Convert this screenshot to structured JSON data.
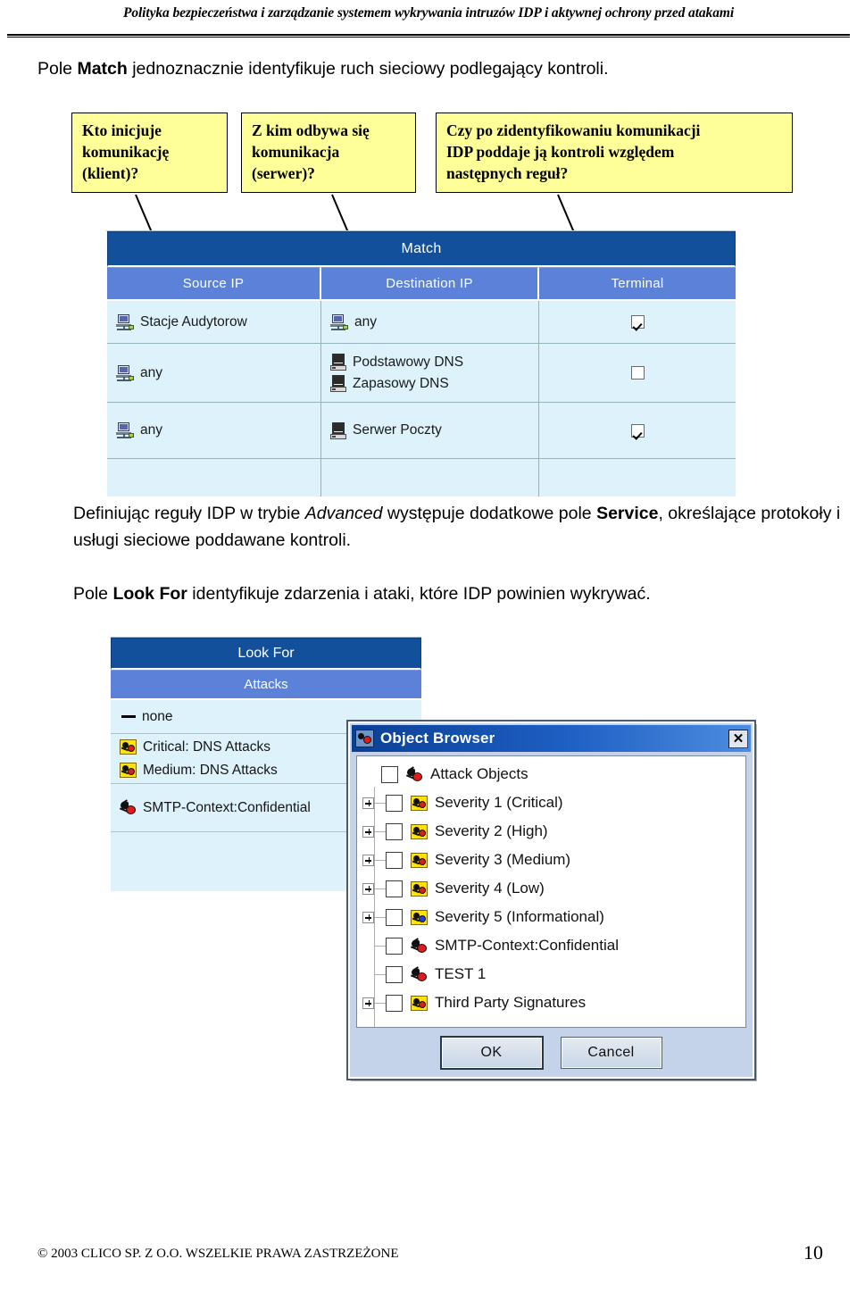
{
  "header": {
    "running_title": "Polityka bezpieczeństwa i zarządzanie systemem wykrywania intruzów IDP i aktywnej ochrony przed atakami"
  },
  "paragraphs": {
    "p1_prefix": "Pole ",
    "p1_bold": "Match",
    "p1_suffix": " jednoznacznie identyfikuje ruch sieciowy podlegający kontroli.",
    "p2_a": "Definiując reguły IDP w trybie ",
    "p2_italic": "Advanced",
    "p2_b": " występuje dodatkowe pole ",
    "p2_bold": "Service",
    "p2_c": ", określające protokoły i usługi sieciowe poddawane kontroli.",
    "p3_prefix": "Pole ",
    "p3_bold": "Look For",
    "p3_suffix": " identyfikuje zdarzenia i ataki, które IDP powinien wykrywać."
  },
  "callouts": [
    {
      "name": "callout-source",
      "lines": [
        "Kto inicjuje",
        "komunikację",
        "(klient)?"
      ]
    },
    {
      "name": "callout-destination",
      "lines": [
        "Z kim odbywa się",
        "komunikacja",
        "(serwer)?"
      ]
    },
    {
      "name": "callout-terminal",
      "lines": [
        "Czy po zidentyfikowaniu komunikacji",
        "IDP poddaje ją kontroli względem",
        "następnych reguł?"
      ]
    }
  ],
  "match_table": {
    "title": "Match",
    "columns": [
      "Source IP",
      "Destination IP",
      "Terminal"
    ],
    "rows": [
      {
        "source": [
          "Stacje Audytorow"
        ],
        "source_icon": "network-icon",
        "destination": [
          "any"
        ],
        "destination_icon": "network-icon",
        "terminal": true
      },
      {
        "source": [
          "any"
        ],
        "source_icon": "network-icon",
        "destination": [
          "Podstawowy DNS",
          "Zapasowy DNS"
        ],
        "destination_icon": "server-icon",
        "terminal": false
      },
      {
        "source": [
          "any"
        ],
        "source_icon": "network-icon",
        "destination": [
          "Serwer Poczty"
        ],
        "destination_icon": "server-icon",
        "terminal": true
      },
      {
        "source": [],
        "destination": [],
        "terminal": null
      }
    ],
    "colors": {
      "title_bg": "#13509c",
      "column_bg": "#5b82d8",
      "row_bg": "#ddf2fb"
    }
  },
  "look_for": {
    "title": "Look For",
    "subtitle": "Attacks",
    "groups": [
      {
        "items": [
          {
            "icon": "dash-icon",
            "label": "none"
          }
        ]
      },
      {
        "items": [
          {
            "icon": "severity-icon",
            "label": "Critical: DNS Attacks"
          },
          {
            "icon": "severity-icon",
            "label": "Medium: DNS Attacks"
          }
        ]
      },
      {
        "items": [
          {
            "icon": "attack-icon",
            "label": "SMTP-Context:Confidential"
          }
        ]
      },
      {
        "items": []
      }
    ],
    "colors": {
      "title_bg": "#13509c",
      "subtitle_bg": "#5b82d8",
      "row_bg": "#ddf2fb"
    }
  },
  "object_browser": {
    "title": "Object Browser",
    "close_label": "✕",
    "tree": [
      {
        "label": "Attack Objects",
        "expandable": false,
        "checked": false,
        "icon": "attack-objects-icon",
        "indent": 0
      },
      {
        "label": "Severity 1  (Critical)",
        "expandable": true,
        "checked": false,
        "icon": "severity-icon",
        "indent": 1
      },
      {
        "label": "Severity 2 (High)",
        "expandable": true,
        "checked": false,
        "icon": "severity-icon",
        "indent": 1
      },
      {
        "label": "Severity 3 (Medium)",
        "expandable": true,
        "checked": false,
        "icon": "severity-icon",
        "indent": 1
      },
      {
        "label": "Severity 4 (Low)",
        "expandable": true,
        "checked": false,
        "icon": "severity-icon",
        "indent": 1
      },
      {
        "label": "Severity 5 (Informational)",
        "expandable": true,
        "checked": false,
        "icon": "severity-info-icon",
        "indent": 1
      },
      {
        "label": "SMTP-Context:Confidential",
        "expandable": false,
        "checked": false,
        "icon": "attack-icon",
        "indent": 1
      },
      {
        "label": "TEST 1",
        "expandable": false,
        "checked": false,
        "icon": "attack-icon",
        "indent": 1
      },
      {
        "label": "Third Party Signatures",
        "expandable": true,
        "checked": false,
        "icon": "severity-icon",
        "indent": 1
      }
    ],
    "buttons": {
      "ok": "OK",
      "cancel": "Cancel"
    }
  },
  "footer": {
    "copyright_main": "© 2003 CLICO S",
    "copyright_small1": "P",
    "copyright_mid": ". Z",
    "copyright_small2": " O.O. W",
    "copyright_small3": "SZELKIE PRAWA ZASTRZEŻONE",
    "copyright_full": "© 2003 CLICO SP. Z O.O. WSZELKIE PRAWA ZASTRZEŻONE",
    "page_number": "10"
  }
}
